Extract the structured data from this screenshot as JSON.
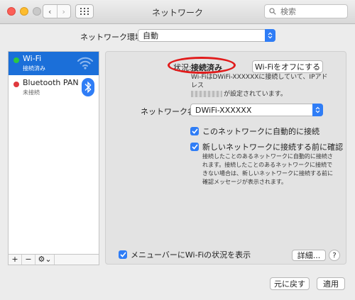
{
  "window": {
    "title": "ネットワーク",
    "nav_back": "‹",
    "nav_forward": "›",
    "search_placeholder": "検索"
  },
  "location": {
    "label": "ネットワーク環境:",
    "value": "自動"
  },
  "sidebar": {
    "items": [
      {
        "name": "Wi-Fi",
        "status": "接続済み",
        "status_color": "#2dc840",
        "icon": "wifi-icon"
      },
      {
        "name": "Bluetooth PAN",
        "status": "未接続",
        "status_color": "#e0393e",
        "icon": "bluetooth-icon"
      }
    ],
    "tools": {
      "add": "+",
      "remove": "−",
      "gear": "⚙⌄"
    }
  },
  "panel": {
    "status_label": "状況:",
    "status_value": "接続済み",
    "wifi_off_button": "Wi-Fiをオフにする",
    "description_line1": "Wi-FiはDWiFi-XXXXXXに接続していて、IPアドレス",
    "description_line2": "が設定されています。",
    "network_name_label": "ネットワーク名:",
    "network_name_value": "DWiFi-XXXXXX",
    "auto_join_label": "このネットワークに自動的に接続",
    "ask_join_label": "新しいネットワークに接続する前に確認",
    "ask_join_description": "接続したことのあるネットワークに自動的に接続されます。接続したことのあるネットワークに接続できない場合は、新しいネットワークに接続する前に確認メッセージが表示されます。",
    "show_menu_label": "メニューバーにWi-Fiの状況を表示",
    "advanced_button": "詳細...",
    "help_button": "?"
  },
  "footer": {
    "revert_button": "元に戻す",
    "apply_button": "適用"
  },
  "colors": {
    "accent": "#2f7df6",
    "selection": "#1b6fd9",
    "highlight_circle": "#e11b1b"
  }
}
